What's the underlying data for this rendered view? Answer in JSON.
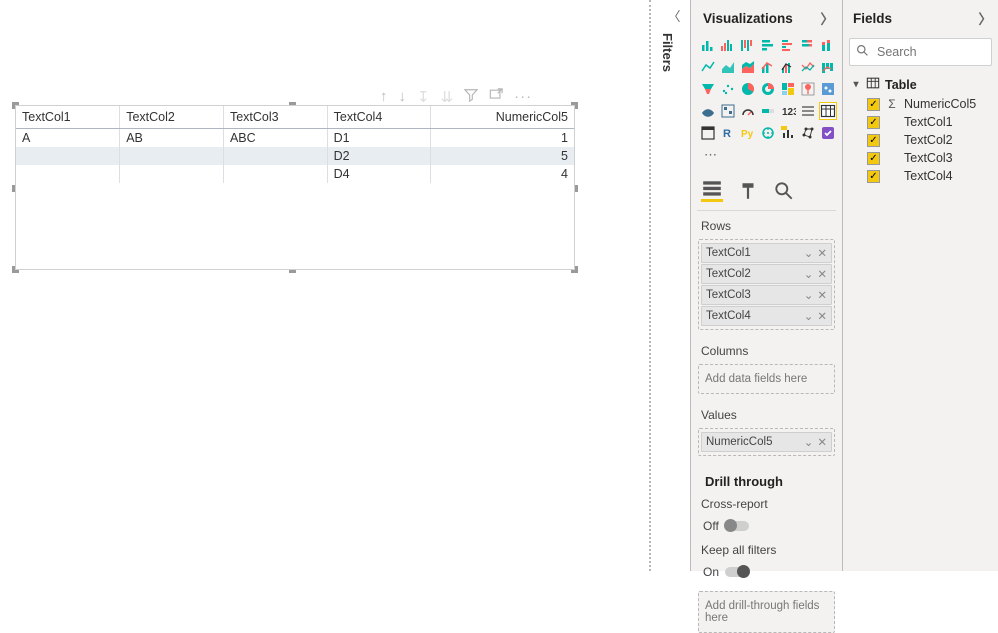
{
  "filters_tab": {
    "label": "Filters"
  },
  "matrix": {
    "headers": [
      "TextCol1",
      "TextCol2",
      "TextCol3",
      "TextCol4",
      "NumericCol5"
    ],
    "rows": [
      {
        "c": [
          "A",
          "AB",
          "ABC",
          "D1",
          "1"
        ],
        "selected": false
      },
      {
        "c": [
          "",
          "",
          "",
          "D2",
          "5"
        ],
        "selected": true
      },
      {
        "c": [
          "",
          "",
          "",
          "D4",
          "4"
        ],
        "selected": false
      }
    ]
  },
  "viz_pane": {
    "title": "Visualizations",
    "rows_label": "Rows",
    "columns_label": "Columns",
    "values_label": "Values",
    "add_placeholder": "Add data fields here",
    "row_wells": [
      "TextCol1",
      "TextCol2",
      "TextCol3",
      "TextCol4"
    ],
    "value_wells": [
      "NumericCol5"
    ],
    "drill": {
      "title": "Drill through",
      "cross_label": "Cross-report",
      "cross_state": "Off",
      "keepall_label": "Keep all filters",
      "keepall_state": "On",
      "footer": "Add drill-through fields here"
    }
  },
  "fields_pane": {
    "title": "Fields",
    "search_placeholder": "Search",
    "table_name": "Table",
    "fields": [
      {
        "name": "NumericCol5",
        "sigma": true
      },
      {
        "name": "TextCol1",
        "sigma": false
      },
      {
        "name": "TextCol2",
        "sigma": false
      },
      {
        "name": "TextCol3",
        "sigma": false
      },
      {
        "name": "TextCol4",
        "sigma": false
      }
    ]
  },
  "chart_data": {
    "type": "table",
    "columns": [
      "TextCol1",
      "TextCol2",
      "TextCol3",
      "TextCol4",
      "NumericCol5"
    ],
    "rows": [
      [
        "A",
        "AB",
        "ABC",
        "D1",
        1
      ],
      [
        "A",
        "AB",
        "ABC",
        "D2",
        5
      ],
      [
        "A",
        "AB",
        "ABC",
        "D4",
        4
      ]
    ]
  }
}
